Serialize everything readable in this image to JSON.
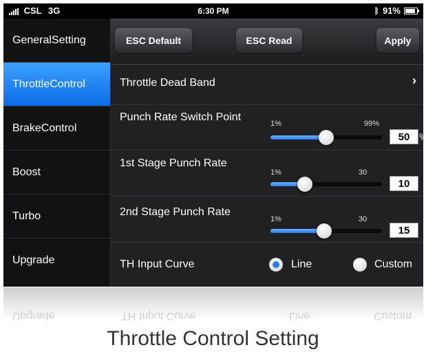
{
  "status": {
    "carrier": "CSL",
    "network": "3G",
    "time": "6:30 PM",
    "battery": "91%"
  },
  "toolbar": {
    "esc_default": "ESC Default",
    "esc_read": "ESC Read",
    "apply": "Apply"
  },
  "sidebar": {
    "items": [
      {
        "label": "GeneralSetting"
      },
      {
        "label": "ThrottleControl"
      },
      {
        "label": "BrakeControl"
      },
      {
        "label": "Boost"
      },
      {
        "label": "Turbo"
      },
      {
        "label": "Upgrade"
      }
    ]
  },
  "rows": {
    "dead_band": {
      "label": "Throttle Dead Band"
    },
    "punch_switch": {
      "label": "Punch Rate Switch Point",
      "min": "1%",
      "max": "99%",
      "value": "50",
      "unit": "%",
      "level": 0.5
    },
    "stage1": {
      "label": "1st Stage Punch Rate",
      "min": "1%",
      "max": "30",
      "value": "10",
      "level": 0.31
    },
    "stage2": {
      "label": "2nd Stage Punch Rate",
      "min": "1%",
      "max": "30",
      "value": "15",
      "level": 0.48
    },
    "curve": {
      "label": "TH Input Curve",
      "option_line": "Line",
      "option_custom": "Custom",
      "selected": "Line"
    }
  },
  "reflection": {
    "row_label": "TH Input Curve",
    "option_line": "Line",
    "option_custom": "Custom",
    "side_label": "Upgrade"
  },
  "caption": "Throttle Control Setting",
  "colors": {
    "accent": "#1f7cf0",
    "background": "#1a1a1c"
  }
}
